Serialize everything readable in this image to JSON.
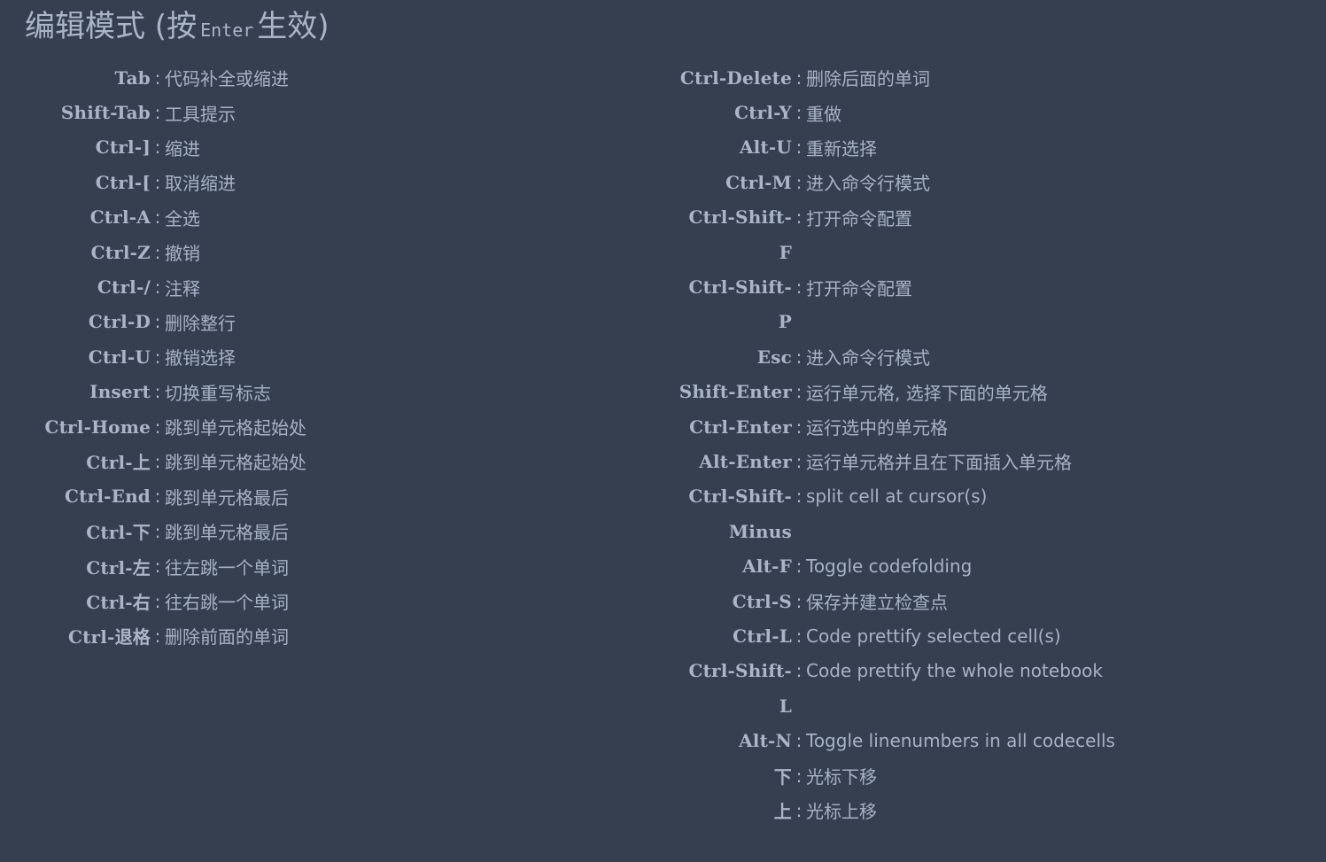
{
  "title": {
    "prefix": "编辑模式 (按",
    "key": "Enter",
    "suffix": "生效)"
  },
  "separator": ":",
  "left_shortcuts": [
    {
      "key": "Tab",
      "desc": "代码补全或缩进"
    },
    {
      "key": "Shift-Tab",
      "desc": "工具提示"
    },
    {
      "key": "Ctrl-]",
      "desc": "缩进"
    },
    {
      "key": "Ctrl-[",
      "desc": "取消缩进"
    },
    {
      "key": "Ctrl-A",
      "desc": "全选"
    },
    {
      "key": "Ctrl-Z",
      "desc": "撤销"
    },
    {
      "key": "Ctrl-/",
      "desc": "注释"
    },
    {
      "key": "Ctrl-D",
      "desc": "删除整行"
    },
    {
      "key": "Ctrl-U",
      "desc": "撤销选择"
    },
    {
      "key": "Insert",
      "desc": "切换重写标志"
    },
    {
      "key": "Ctrl-Home",
      "desc": "跳到单元格起始处"
    },
    {
      "key": "Ctrl-上",
      "desc": "跳到单元格起始处"
    },
    {
      "key": "Ctrl-End",
      "desc": "跳到单元格最后"
    },
    {
      "key": "Ctrl-下",
      "desc": "跳到单元格最后"
    },
    {
      "key": "Ctrl-左",
      "desc": "往左跳一个单词"
    },
    {
      "key": "Ctrl-右",
      "desc": "往右跳一个单词"
    },
    {
      "key": "Ctrl-退格",
      "desc": "删除前面的单词"
    }
  ],
  "right_shortcuts": [
    {
      "key": "Ctrl-Delete",
      "desc": "删除后面的单词"
    },
    {
      "key": "Ctrl-Y",
      "desc": "重做"
    },
    {
      "key": "Alt-U",
      "desc": "重新选择"
    },
    {
      "key": "Ctrl-M",
      "desc": "进入命令行模式"
    },
    {
      "key": "Ctrl-Shift-",
      "desc": "打开命令配置",
      "cont": "F"
    },
    {
      "key": "Ctrl-Shift-",
      "desc": "打开命令配置",
      "cont": "P"
    },
    {
      "key": "Esc",
      "desc": "进入命令行模式"
    },
    {
      "key": "Shift-Enter",
      "desc": "运行单元格, 选择下面的单元格"
    },
    {
      "key": "Ctrl-Enter",
      "desc": "运行选中的单元格"
    },
    {
      "key": "Alt-Enter",
      "desc": "运行单元格并且在下面插入单元格"
    },
    {
      "key": "Ctrl-Shift-",
      "desc": "split cell at cursor(s)",
      "cont": "Minus"
    },
    {
      "key": "Alt-F",
      "desc": "Toggle codefolding"
    },
    {
      "key": "Ctrl-S",
      "desc": "保存并建立检查点"
    },
    {
      "key": "Ctrl-L",
      "desc": "Code prettify selected cell(s)"
    },
    {
      "key": "Ctrl-Shift-",
      "desc": "Code prettify the whole notebook",
      "cont": "L"
    },
    {
      "key": "Alt-N",
      "desc": "Toggle linenumbers in all codecells"
    },
    {
      "key": "下",
      "desc": "光标下移"
    },
    {
      "key": "上",
      "desc": "光标上移"
    }
  ]
}
